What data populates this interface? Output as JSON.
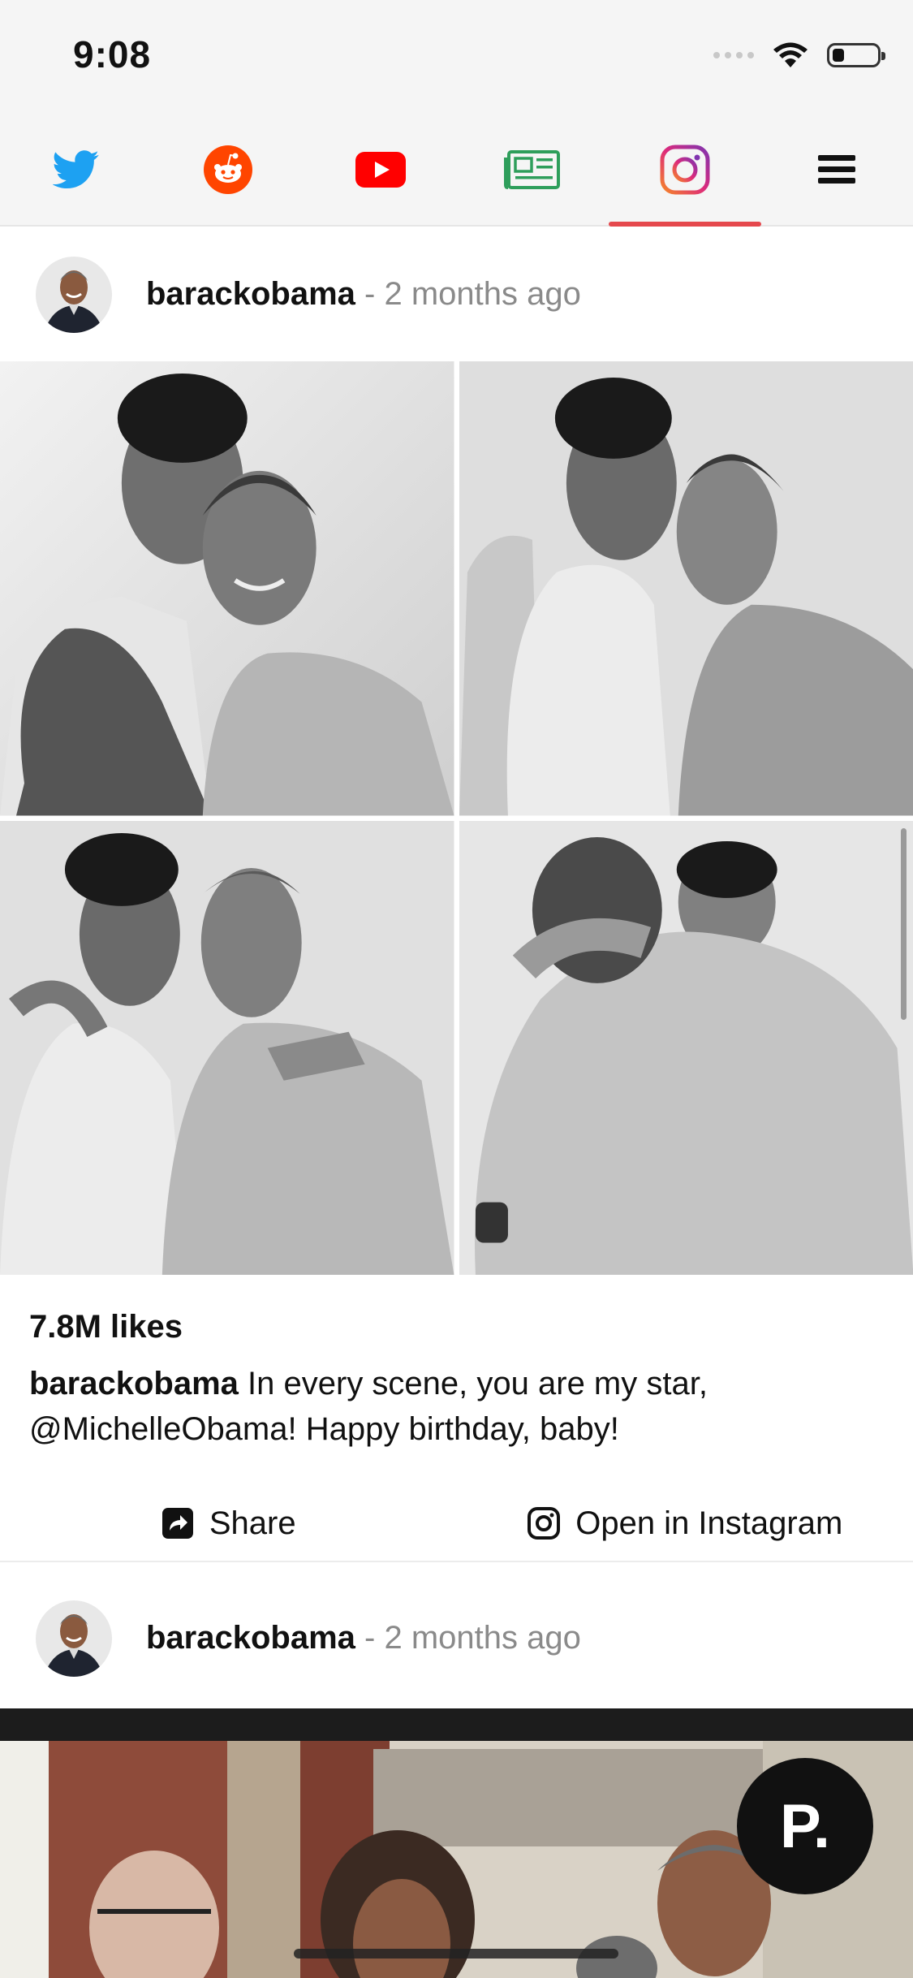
{
  "status_bar": {
    "time": "9:08"
  },
  "tabs": [
    {
      "icon": "twitter-icon",
      "color": "#1DA1F2",
      "active": false
    },
    {
      "icon": "reddit-icon",
      "color": "#FF4500",
      "active": false
    },
    {
      "icon": "youtube-icon",
      "color": "#FF0000",
      "active": false
    },
    {
      "icon": "news-icon",
      "color": "#2E9E5B",
      "active": false
    },
    {
      "icon": "instagram-icon",
      "color": "#C13584",
      "active": true
    },
    {
      "icon": "menu-icon",
      "color": "#111111",
      "active": false
    }
  ],
  "accent_color": "#E5484D",
  "posts": [
    {
      "username": "barackobama",
      "time_ago": "- 2 months ago",
      "likes": "7.8M likes",
      "caption_user": "barackobama",
      "caption_text": " In every scene, you are my star, @MichelleObama! Happy birthday, baby!",
      "share_label": "Share",
      "open_label": "Open in Instagram"
    },
    {
      "username": "barackobama",
      "time_ago": "- 2 months ago"
    }
  ],
  "fab": {
    "label": "P."
  }
}
